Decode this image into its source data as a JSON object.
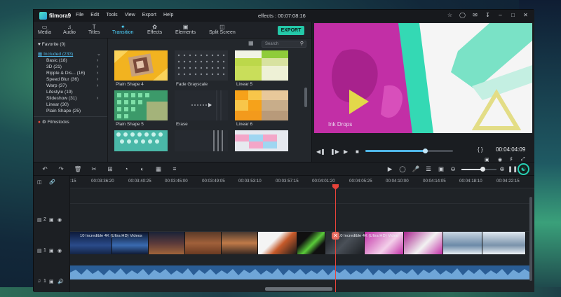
{
  "app": {
    "title": "effects : 00:07:08:16",
    "logo_text": "filmora9",
    "menu": [
      "File",
      "Edit",
      "Tools",
      "View",
      "Export",
      "Help"
    ]
  },
  "tabs": [
    {
      "label": "Media",
      "icon": "folder-icon"
    },
    {
      "label": "Audio",
      "icon": "music-note-icon"
    },
    {
      "label": "Titles",
      "icon": "text-icon"
    },
    {
      "label": "Transition",
      "icon": "transition-icon",
      "active": true
    },
    {
      "label": "Effects",
      "icon": "effects-icon"
    },
    {
      "label": "Elements",
      "icon": "elements-icon"
    },
    {
      "label": "Split Screen",
      "icon": "split-screen-icon"
    }
  ],
  "export_label": "EXPORT",
  "sidebar": {
    "favorite": "Favorite (0)",
    "included": "Included (233)",
    "categories": [
      {
        "label": "Basic (18)",
        "arrow": true
      },
      {
        "label": "3D (21)",
        "arrow": true
      },
      {
        "label": "Ripple & Dis... (16)",
        "arrow": true
      },
      {
        "label": "Speed Blur (36)",
        "arrow": true
      },
      {
        "label": "Warp (37)",
        "arrow": true
      },
      {
        "label": "Lifestyle (19)",
        "arrow": false
      },
      {
        "label": "Slideshow (31)",
        "arrow": true
      },
      {
        "label": "Linear (30)",
        "arrow": false
      },
      {
        "label": "Plain Shape (25)",
        "arrow": false
      }
    ],
    "filmstocks": "Filmstocks"
  },
  "search_placeholder": "Search",
  "thumbnails": [
    "Plain Shape 4",
    "Fade Grayscale",
    "Linear 5",
    "Plain Shape 5",
    "Erase",
    "Linear 6"
  ],
  "preview": {
    "overlay_text": "Ink Drops",
    "timecode": "00:04:04:09",
    "progress": 0.68
  },
  "toolbar_icons": [
    "undo-icon",
    "redo-icon",
    "delete-icon",
    "cut-icon",
    "crop-icon",
    "speed-icon",
    "color-icon",
    "green-screen-icon",
    "audio-mixer-icon"
  ],
  "zoom_level": 0.6,
  "ruler": [
    "00:03:36:20",
    "00:03:40:25",
    "00:03:45:00",
    "00:03:49:05",
    "00:03:53:10",
    "00:03:57:15",
    "00:04:01:20",
    "00:04:05:25",
    "00:04:10:00",
    "00:04:14:05",
    "00:04:18:10",
    "00:04:22:15"
  ],
  "ruler_left_partial": ":15",
  "tracks": {
    "video2": "2",
    "video1": "1",
    "audio1": "1"
  },
  "clip_captions": [
    "10 Incredible 4K (Ultra HD) Videos",
    "10 Incredible 4K (Ultra HD) Video"
  ]
}
